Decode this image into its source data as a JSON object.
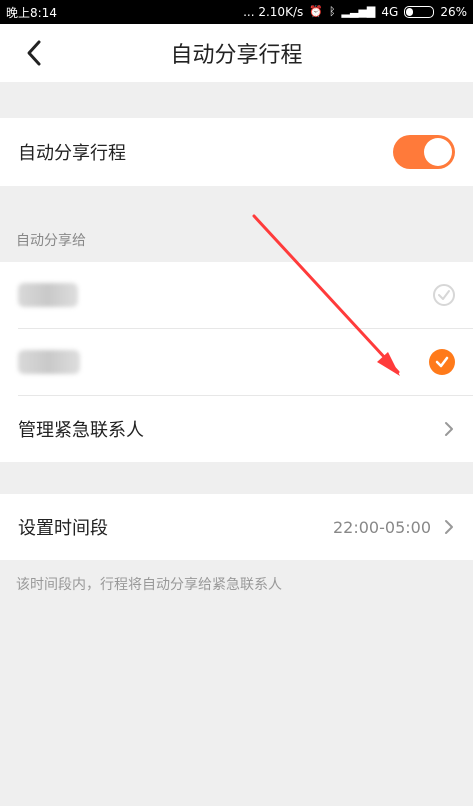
{
  "status_bar": {
    "time": "晚上8:14",
    "network_speed": "... 2.10K/s",
    "network_type": "4G",
    "battery": "26%"
  },
  "header": {
    "title": "自动分享行程",
    "back_icon": "chevron-left-icon"
  },
  "auto_share": {
    "label": "自动分享行程",
    "enabled": true
  },
  "share_to": {
    "section_label": "自动分享给",
    "contacts": [
      {
        "checked": false
      },
      {
        "checked": true
      }
    ],
    "manage_label": "管理紧急联系人"
  },
  "time_setting": {
    "label": "设置时间段",
    "value": "22:00-05:00",
    "note": "该时间段内，行程将自动分享给紧急联系人"
  },
  "colors": {
    "accent": "#ff7a3a",
    "check_fill": "#ff7a1a",
    "background": "#efefef",
    "annotation_arrow": "#ff3b3b"
  }
}
